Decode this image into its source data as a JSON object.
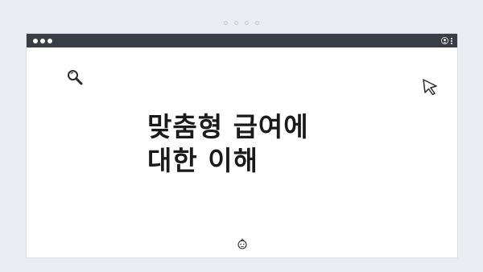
{
  "page": {
    "background": "#e9ecf1",
    "pager_dots": 4
  },
  "window": {
    "titlebar_color": "#3a3d45",
    "icons": [
      "user-icon",
      "kebab-menu-icon"
    ]
  },
  "main": {
    "headline_line1": "맞춤형 급여에",
    "headline_line2": "대한 이해",
    "icons": [
      "search-icon",
      "cursor-icon",
      "face-icon"
    ]
  }
}
